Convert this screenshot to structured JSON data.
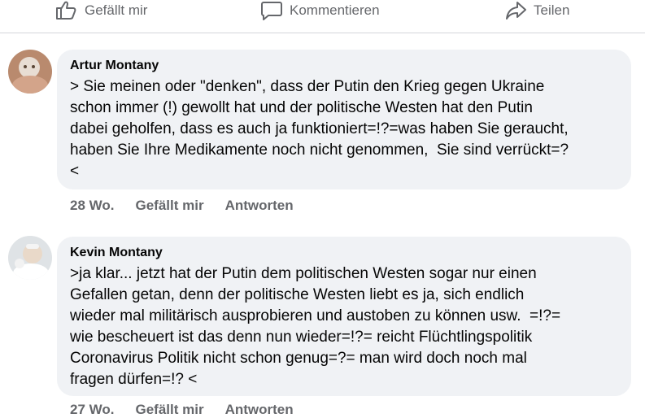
{
  "actions": {
    "like": "Gefällt mir",
    "comment": "Kommentieren",
    "share": "Teilen"
  },
  "comments": [
    {
      "author": "Artur Montany",
      "text": "> Sie meinen oder \"denken\", dass der Putin den Krieg gegen Ukraine\nschon immer (!) gewollt hat und der politische Westen hat den Putin\ndabei geholfen, dass es auch ja funktioniert=!?=was haben Sie geraucht,\nhaben Sie Ihre Medikamente noch nicht genommen,  Sie sind verrückt=?\n<",
      "time": "28 Wo.",
      "like": "Gefällt mir",
      "reply": "Antworten"
    },
    {
      "author": "Kevin Montany",
      "text": ">ja klar... jetzt hat der Putin dem politischen Westen sogar nur einen\nGefallen getan, denn der politische Westen liebt es ja, sich endlich\nwieder mal militärisch ausprobieren und austoben zu können usw.  =!?=\nwie bescheuert ist das denn nun wieder=!?= reicht Flüchtlingspolitik\nCoronavirus Politik nicht schon genug=?= man wird doch noch mal\nfragen dürfen=!? <",
      "time": "27 Wo.",
      "like": "Gefällt mir",
      "reply": "Antworten"
    }
  ],
  "colors": {
    "muted": "#65676b",
    "bubble": "#f0f2f5",
    "divider": "#d3d6da"
  }
}
